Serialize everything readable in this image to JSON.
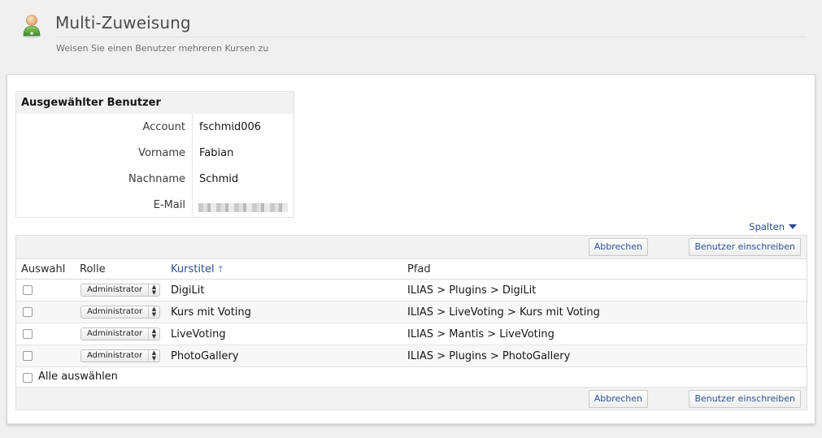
{
  "header": {
    "title": "Multi-Zuweisung",
    "subtitle": "Weisen Sie einen Benutzer mehreren Kursen zu"
  },
  "user_info": {
    "heading": "Ausgewählter Benutzer",
    "rows": [
      {
        "label": "Account",
        "value": "fschmid006"
      },
      {
        "label": "Vorname",
        "value": "Fabian"
      },
      {
        "label": "Nachname",
        "value": "Schmid"
      },
      {
        "label": "E-Mail",
        "value": ""
      }
    ]
  },
  "table": {
    "columns_toggle": "Spalten",
    "buttons": {
      "cancel": "Abbrechen",
      "enroll": "Benutzer einschreiben"
    },
    "headers": {
      "select": "Auswahl",
      "role": "Rolle",
      "course": "Kurstitel",
      "path": "Pfad"
    },
    "sort_indicator": "↑",
    "rows": [
      {
        "role": "Administrator",
        "course": "DigiLit",
        "path": "ILIAS > Plugins > DigiLit"
      },
      {
        "role": "Administrator",
        "course": "Kurs mit Voting",
        "path": "ILIAS > LiveVoting > Kurs mit Voting"
      },
      {
        "role": "Administrator",
        "course": "LiveVoting",
        "path": "ILIAS > Mantis > LiveVoting"
      },
      {
        "role": "Administrator",
        "course": "PhotoGallery",
        "path": "ILIAS > Plugins > PhotoGallery"
      }
    ],
    "select_all": "Alle auswählen"
  },
  "icons": {
    "user": "user-icon",
    "sort": "sort-ascending-icon",
    "dropdown": "triangle-down-icon",
    "select_arrows": "updown-arrows-icon"
  }
}
